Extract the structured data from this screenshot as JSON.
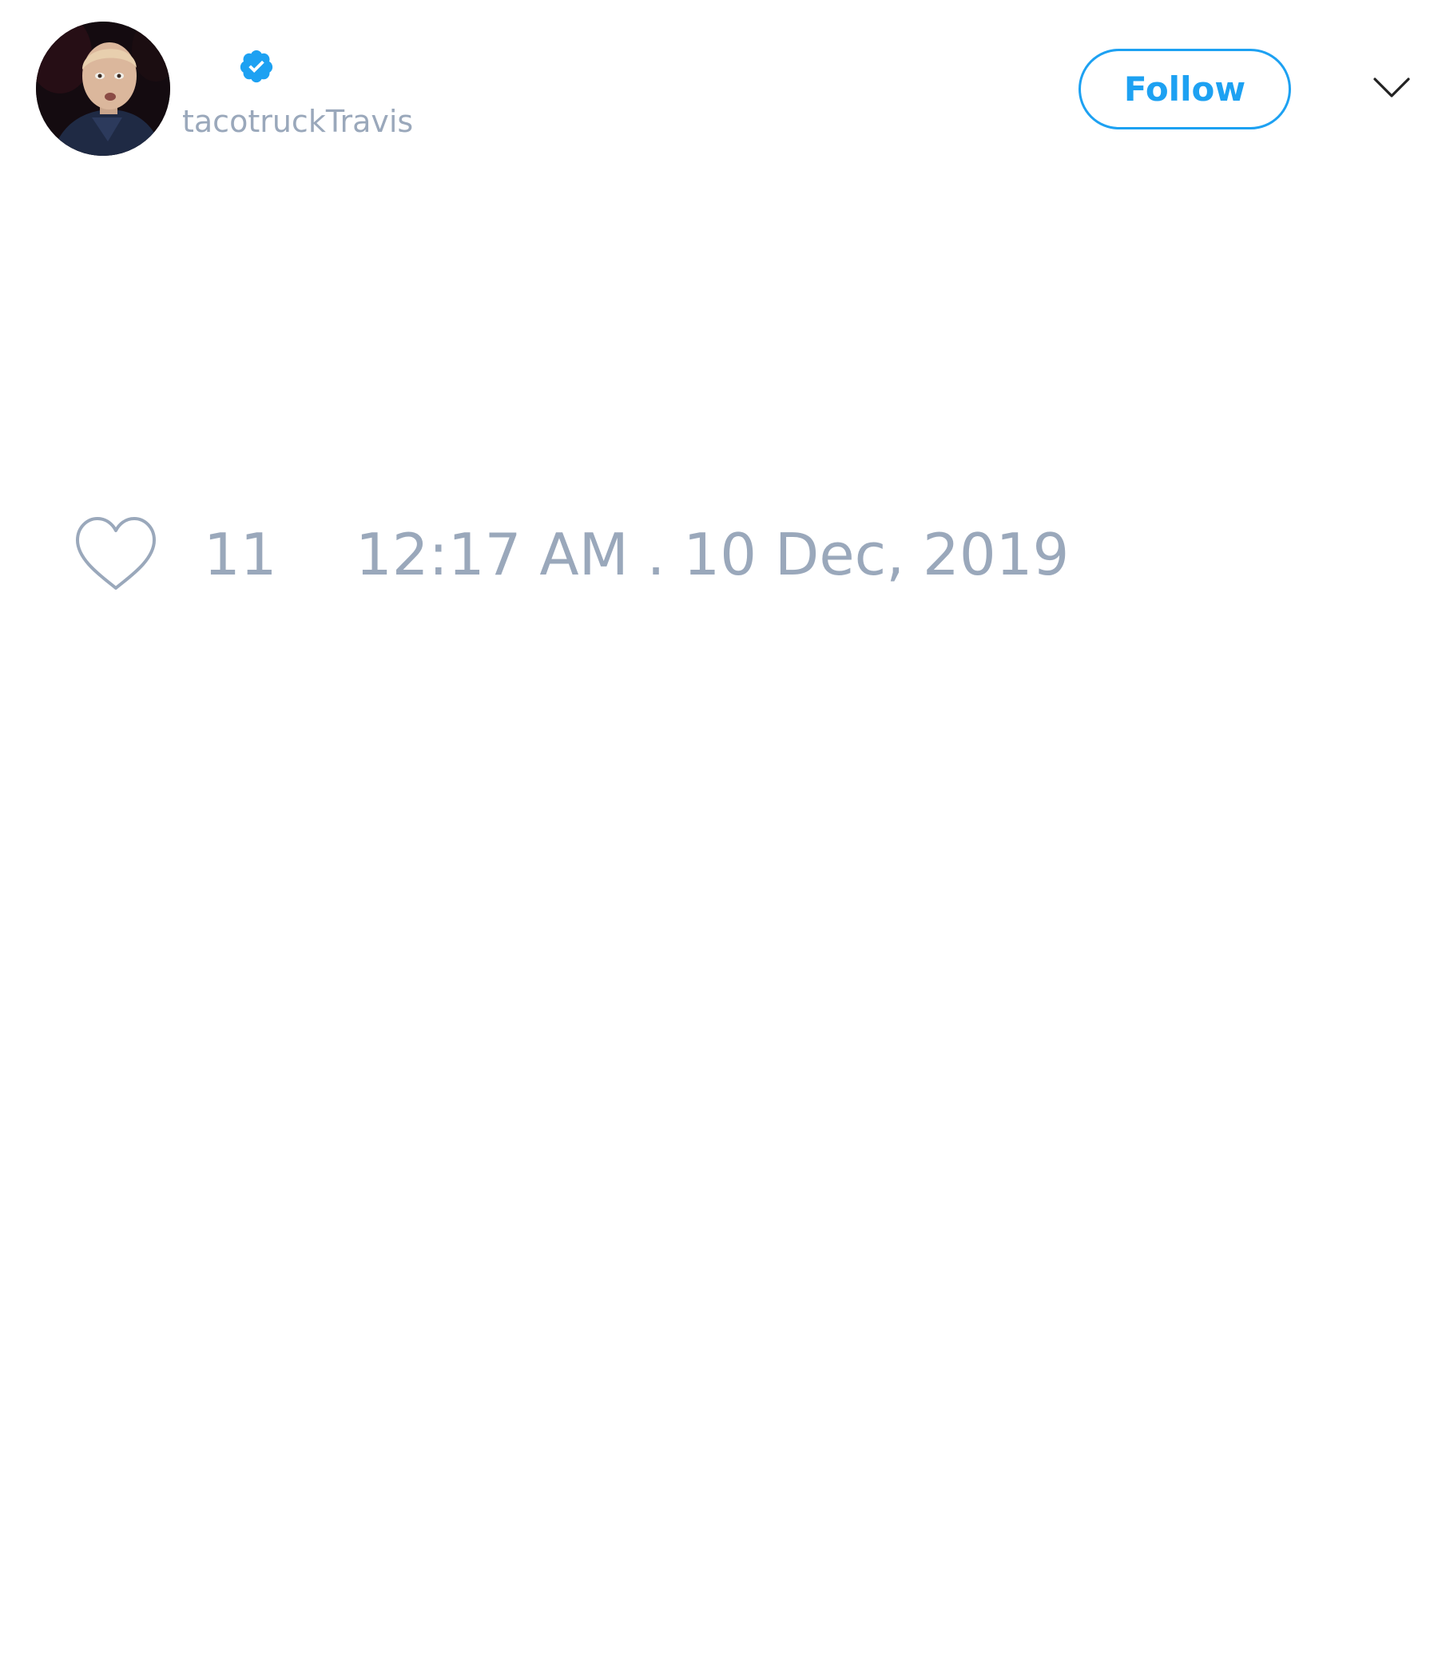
{
  "user": {
    "avatar_alt": "profile photo",
    "verified": true,
    "username": "tacotruckTravis"
  },
  "actions": {
    "follow_label": "Follow",
    "more_icon": "chevron-down-icon"
  },
  "stats": {
    "like_icon": "heart-outline-icon",
    "like_count": "11",
    "timestamp": "12:17 AM . 10 Dec, 2019"
  },
  "colors": {
    "accent": "#1da1f2",
    "muted_text": "#9aa8bb",
    "background": "#ffffff"
  }
}
